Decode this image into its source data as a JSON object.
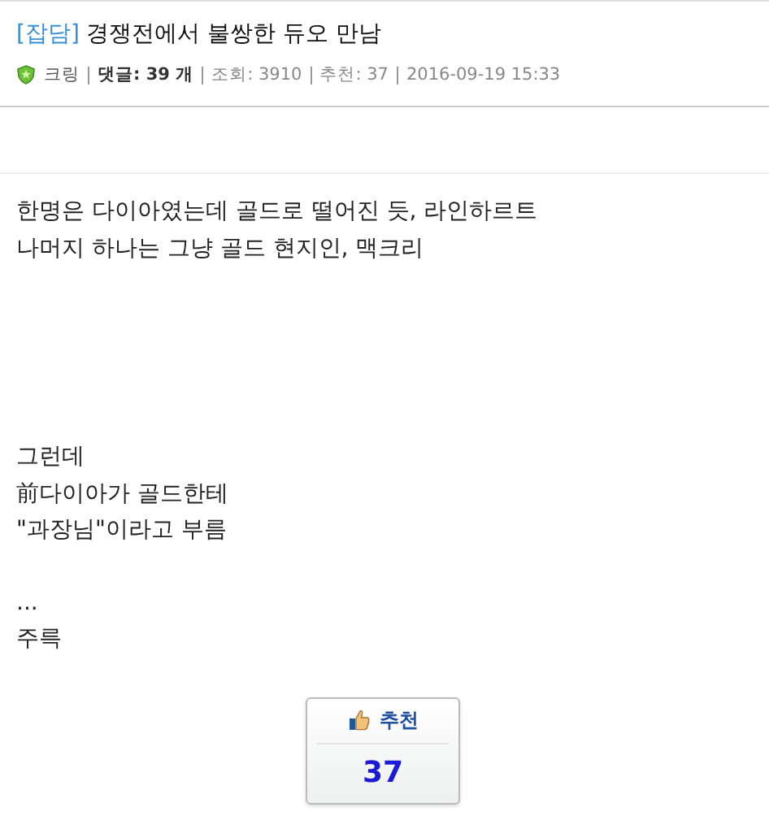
{
  "post": {
    "category": "[잡담]",
    "title": "경쟁전에서 불쌍한 듀오 만남",
    "meta": [
      {
        "kind": "author",
        "text": "크링"
      },
      {
        "kind": "comments",
        "text": "댓글: 39 개"
      },
      {
        "kind": "stat",
        "text": "조회: 3910"
      },
      {
        "kind": "stat",
        "text": "추천: 37"
      },
      {
        "kind": "stat",
        "text": "2016-09-19 15:33"
      }
    ],
    "body": [
      [
        "한명은 다이아였는데 골드로 떨어진 듯, 라인하르트",
        "나머지 하나는 그냥 골드 현지인, 맥크리"
      ],
      [
        "그런데",
        "前다이아가 골드한테",
        "\"과장님\"이라고 부름"
      ],
      [
        "...",
        "주륵"
      ]
    ],
    "recommend": {
      "label": "추천",
      "count": "37"
    }
  }
}
